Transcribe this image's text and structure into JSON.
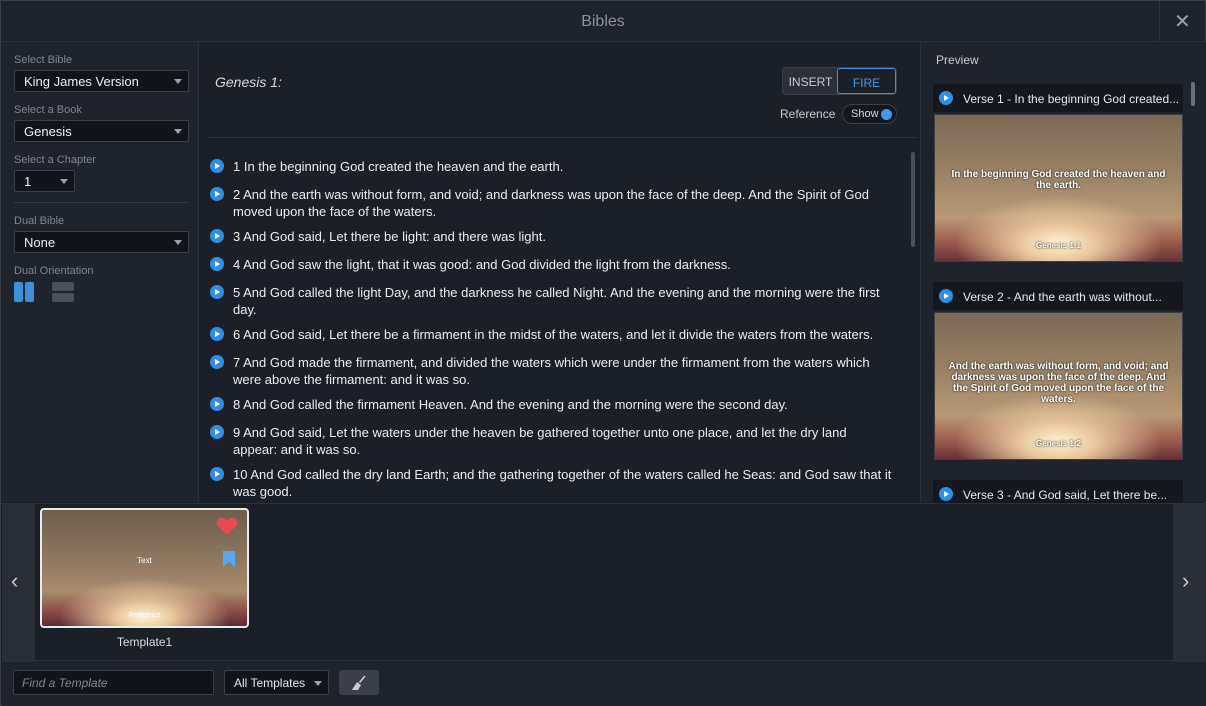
{
  "window": {
    "title": "Bibles",
    "close_glyph": "✕"
  },
  "left": {
    "select_bible_label": "Select Bible",
    "bible_value": "King James Version",
    "select_book_label": "Select a Book",
    "book_value": "Genesis",
    "select_chapter_label": "Select a Chapter",
    "chapter_value": "1",
    "dual_bible_label": "Dual Bible",
    "dual_bible_value": "None",
    "dual_orientation_label": "Dual Orientation"
  },
  "center": {
    "reference_title": "Genesis 1:",
    "insert_label": "INSERT",
    "fire_label": "FIRE",
    "reference_label": "Reference",
    "show_label": "Show",
    "verses": [
      "1 In the beginning God created the heaven and the earth.",
      "2 And the earth was without form, and void; and darkness was upon the face of the deep. And the Spirit of God moved upon the face of the waters.",
      "3 And God said, Let there be light: and there was light.",
      "4 And God saw the light, that it was good: and God divided the light from the darkness.",
      "5 And God called the light Day, and the darkness he called Night. And the evening and the morning were the first day.",
      "6 And God said, Let there be a firmament in the midst of the waters, and let it divide the waters from the waters.",
      "7 And God made the firmament, and divided the waters which were under the firmament from the waters which were above the firmament: and it was so.",
      "8 And God called the firmament Heaven. And the evening and the morning were the second day.",
      "9 And God said, Let the waters under the heaven be gathered together unto one place, and let the dry land appear: and it was so.",
      "10 And God called the dry land Earth; and the gathering together of the waters called he Seas: and God saw that it was good."
    ]
  },
  "preview": {
    "label": "Preview",
    "items": [
      {
        "title": "Verse 1 - In the beginning God created...",
        "text": "In the beginning God created the heaven and the earth.",
        "reference": "Genesis 1:1"
      },
      {
        "title": "Verse 2 - And the earth was without...",
        "text": "And the earth was without form, and void; and darkness was upon the face of the deep. And the Spirit of God moved upon the face of the waters.",
        "reference": "Genesis 1:2"
      },
      {
        "title": "Verse 3 - And God said, Let there be..."
      }
    ]
  },
  "templates": {
    "items": [
      {
        "name": "Template1",
        "text_placeholder": "Text",
        "reference_placeholder": "Reference"
      }
    ],
    "prev_glyph": "‹",
    "next_glyph": "›"
  },
  "footer": {
    "search_placeholder": "Find a Template",
    "filter_value": "All Templates"
  },
  "colors": {
    "accent": "#3d9be9",
    "heart": "#e84a4f",
    "bookmark": "#5aa7f0"
  }
}
